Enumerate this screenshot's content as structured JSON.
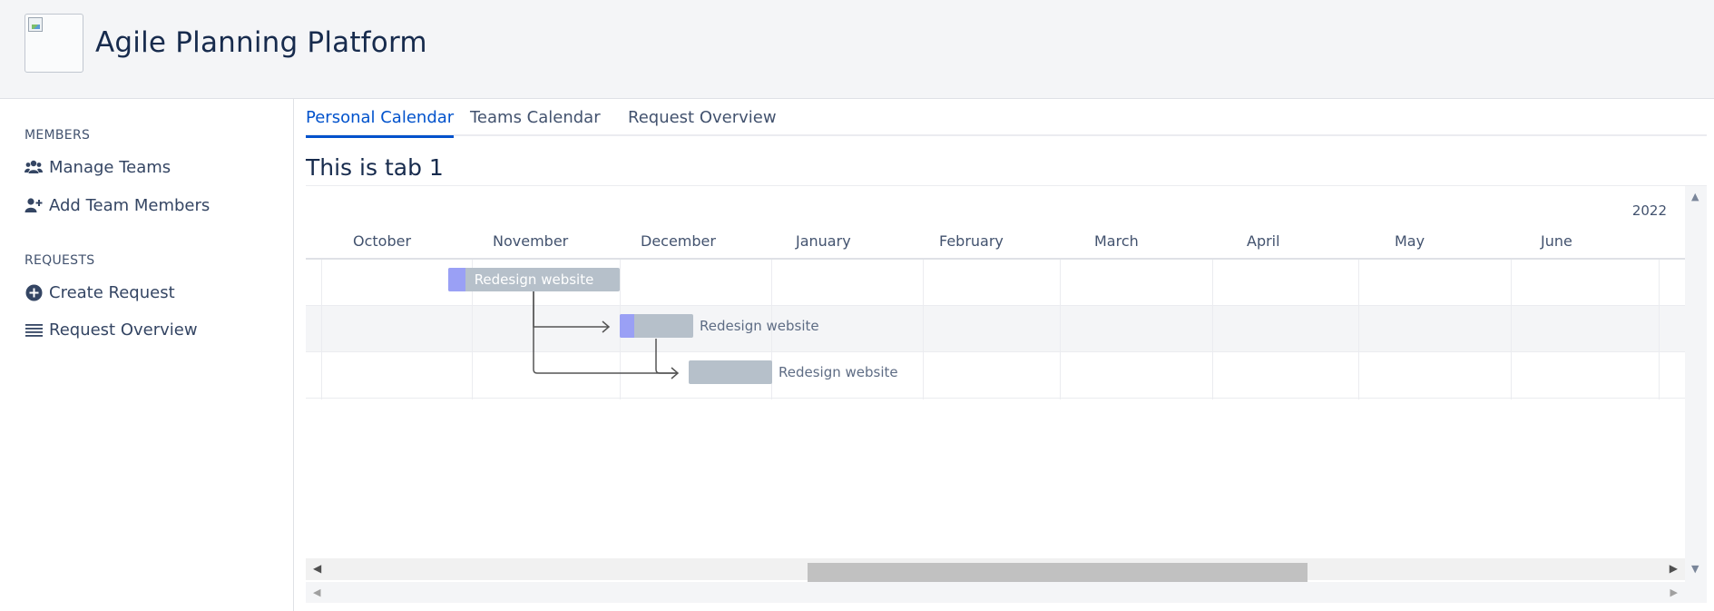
{
  "app": {
    "title": "Agile Planning Platform",
    "logo_icon": "broken-image-icon"
  },
  "sidebar": {
    "sections": [
      {
        "label": "MEMBERS",
        "items": [
          {
            "label": "Manage Teams",
            "icon": "users-icon"
          },
          {
            "label": "Add Team Members",
            "icon": "user-plus-icon"
          }
        ]
      },
      {
        "label": "REQUESTS",
        "items": [
          {
            "label": "Create Request",
            "icon": "plus-circle-icon"
          },
          {
            "label": "Request Overview",
            "icon": "list-icon"
          }
        ]
      }
    ]
  },
  "tabs": [
    {
      "label": "Personal Calendar",
      "active": true
    },
    {
      "label": "Teams Calendar",
      "active": false
    },
    {
      "label": "Request Overview",
      "active": false
    }
  ],
  "tab_content": {
    "heading": "This is tab 1"
  },
  "gantt": {
    "year": "2022",
    "months": [
      "October",
      "November",
      "December",
      "January",
      "February",
      "March",
      "April",
      "May",
      "June"
    ],
    "tasks": [
      {
        "name": "Redesign website",
        "start": "2021-11-01",
        "end": "2021-12-05",
        "progress": 0.1,
        "label_inside": true
      },
      {
        "name": "Redesign website",
        "start": "2021-12-05",
        "end": "2021-12-20",
        "progress": 0.2,
        "label_inside": false
      },
      {
        "name": "Redesign website",
        "start": "2021-12-19",
        "end": "2022-01-06",
        "progress": 0,
        "label_inside": false
      }
    ],
    "dependencies": [
      {
        "from": 0,
        "to": 1
      },
      {
        "from": 0,
        "to": 2
      },
      {
        "from": 1,
        "to": 2
      }
    ],
    "colors": {
      "bar": "#b6c0ca",
      "progress": "#9aa0f5",
      "active_tab": "#0052cc"
    }
  }
}
